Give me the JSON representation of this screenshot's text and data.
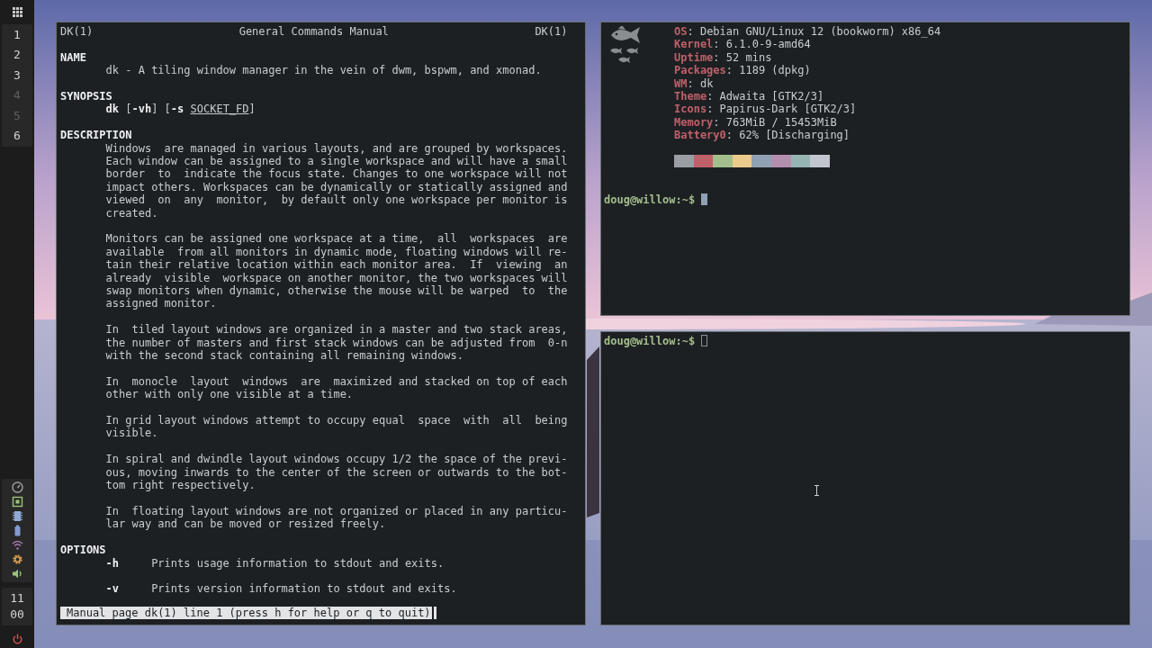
{
  "sidebar": {
    "workspaces": [
      {
        "label": "1",
        "occupied": true
      },
      {
        "label": "2",
        "occupied": true
      },
      {
        "label": "3",
        "occupied": true
      },
      {
        "label": "4",
        "occupied": false
      },
      {
        "label": "5",
        "occupied": false
      },
      {
        "label": "6",
        "occupied": true
      }
    ],
    "clock": {
      "hour": "11",
      "minute": "00"
    }
  },
  "man_window": {
    "header": {
      "left": "DK(1)",
      "center": "General Commands Manual",
      "right": "DK(1)"
    },
    "sections": [
      {
        "title": "NAME",
        "kind": "text",
        "paragraphs": [
          [
            "dk - A tiling window manager in the vein of dwm, bspwm, and xmonad."
          ]
        ]
      },
      {
        "title": "SYNOPSIS",
        "kind": "synopsis",
        "line": "**dk** [**-vh**] [**-s** *SOCKET_FD*]"
      },
      {
        "title": "DESCRIPTION",
        "kind": "text",
        "paragraphs": [
          [
            "Windows  are managed in various layouts, and are grouped by workspaces.",
            "Each window can be assigned to a single workspace and will have a small",
            "border  to  indicate the focus state. Changes to one workspace will not",
            "impact others. Workspaces can be dynamically or statically assigned and",
            "viewed  on  any  monitor,  by default only one workspace per monitor is",
            "created."
          ],
          [
            "Monitors can be assigned one workspace at a time,  all  workspaces  are",
            "available  from all monitors in dynamic mode, floating windows will re-",
            "tain their relative location within each monitor area.  If  viewing  an",
            "already  visible  workspace on another monitor, the two workspaces will",
            "swap monitors when dynamic, otherwise the mouse will be warped  to  the",
            "assigned monitor."
          ],
          [
            "In  tiled layout windows are organized in a master and two stack areas,",
            "the number of masters and first stack windows can be adjusted from  0-n",
            "with the second stack containing all remaining windows."
          ],
          [
            "In  monocle  layout  windows  are  maximized and stacked on top of each",
            "other with only one visible at a time."
          ],
          [
            "In grid layout windows attempt to occupy equal  space  with  all  being",
            "visible."
          ],
          [
            "In spiral and dwindle layout windows occupy 1/2 the space of the previ-",
            "ous, moving inwards to the center of the screen or outwards to the bot-",
            "tom right respectively."
          ],
          [
            "In  floating layout windows are not organized or placed in any particu-",
            "lar way and can be moved or resized freely."
          ]
        ]
      },
      {
        "title": "OPTIONS",
        "kind": "options",
        "options": [
          {
            "flag": "-h",
            "text": "Prints usage information to stdout and exits."
          },
          {
            "flag": "-v",
            "text": "Prints version information to stdout and exits."
          }
        ]
      }
    ],
    "status": "Manual page dk(1) line 1 (press h for help or q to quit)"
  },
  "info_terminal": {
    "info": [
      {
        "key": "OS",
        "value": ": Debian GNU/Linux 12 (bookworm) x86_64"
      },
      {
        "key": "Kernel",
        "value": ": 6.1.0-9-amd64"
      },
      {
        "key": "Uptime",
        "value": ": 52 mins"
      },
      {
        "key": "Packages",
        "value": ": 1189 (dpkg)"
      },
      {
        "key": "WM",
        "value": ": dk"
      },
      {
        "key": "Theme",
        "value": ": Adwaita [GTK2/3]"
      },
      {
        "key": "Icons",
        "value": ": Papirus-Dark [GTK2/3]"
      },
      {
        "key": "Memory",
        "value": ": 763MiB / 15453MiB"
      },
      {
        "key": "Battery0",
        "value": ": 62% [Discharging]"
      }
    ],
    "palette": [
      {
        "color": "#999fa4"
      },
      {
        "color": "#bf616a"
      },
      {
        "color": "#a3be8c"
      },
      {
        "color": "#ebcb8b"
      },
      {
        "color": "#8fa1b3"
      },
      {
        "color": "#b48ead"
      },
      {
        "color": "#96b5b4"
      },
      {
        "color": "#c0c5ce"
      }
    ],
    "prompt": "doug@willow:~$",
    "focused": true
  },
  "shell_terminal": {
    "prompt": "doug@willow:~$",
    "focused": false
  }
}
